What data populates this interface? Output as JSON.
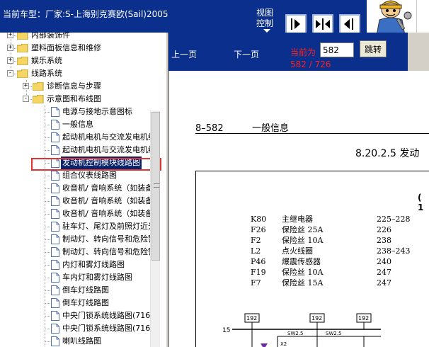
{
  "header": {
    "vehicle_info": "当前车型：厂家:S-上海别克赛欧(Sail)2005",
    "view_control": "视图控制"
  },
  "tree": {
    "items": [
      {
        "label": "内部装饰件",
        "level": 1,
        "type": "folder",
        "expander": "+"
      },
      {
        "label": "塑料面板信息和维修",
        "level": 1,
        "type": "folder",
        "expander": "+"
      },
      {
        "label": "娱乐系统",
        "level": 1,
        "type": "folder",
        "expander": "+"
      },
      {
        "label": "线路系统",
        "level": 1,
        "type": "folder",
        "expander": "-"
      },
      {
        "label": "诊断信息与步骤",
        "level": 2,
        "type": "folder",
        "expander": "+"
      },
      {
        "label": "示意图和布线图",
        "level": 2,
        "type": "folder",
        "expander": "-"
      },
      {
        "label": "电源与接地示意图标",
        "level": 3,
        "type": "doc"
      },
      {
        "label": "一般信息",
        "level": 3,
        "type": "doc"
      },
      {
        "label": "起动机电机与交流发电机线",
        "level": 3,
        "type": "doc"
      },
      {
        "label": "起动机电机与交流发电机线",
        "level": 3,
        "type": "doc"
      },
      {
        "label": "发动机控制模块线路图",
        "level": 3,
        "type": "doc",
        "selected": true
      },
      {
        "label": "组合仪表线路图",
        "level": 3,
        "type": "doc"
      },
      {
        "label": "收音机/ 音响系统（如装备",
        "level": 3,
        "type": "doc"
      },
      {
        "label": "收音机/ 音响系统（如装备",
        "level": 3,
        "type": "doc"
      },
      {
        "label": "收音机/ 音响系统（如装备",
        "level": 3,
        "type": "doc"
      },
      {
        "label": "驻车灯、尾灯及前照灯近光",
        "level": 3,
        "type": "doc"
      },
      {
        "label": "制动灯、转向信号和危险警",
        "level": 3,
        "type": "doc"
      },
      {
        "label": "制动灯、转向信号和危险警",
        "level": 3,
        "type": "doc"
      },
      {
        "label": "内灯和雾灯线路图",
        "level": 3,
        "type": "doc"
      },
      {
        "label": "车内灯和雾灯线路图",
        "level": 3,
        "type": "doc"
      },
      {
        "label": "倒车灯线路图",
        "level": 3,
        "type": "doc"
      },
      {
        "label": "倒车灯线路图",
        "level": 3,
        "type": "doc"
      },
      {
        "label": "中央门锁系统线路图(716",
        "level": 3,
        "type": "doc"
      },
      {
        "label": "中央门锁系统线路图(716",
        "level": 3,
        "type": "doc"
      },
      {
        "label": "喇叭线路图",
        "level": 3,
        "type": "doc"
      }
    ]
  },
  "nav": {
    "prev_label": "上一页",
    "next_label": "下一页",
    "current_label": "当前为",
    "page_value": "582",
    "jump_label": "跳转",
    "page_count": "582 / 726"
  },
  "document": {
    "page_number": "8–582",
    "page_heading": "一般信息",
    "section_title": "8.20.2.5 发动",
    "frame_label": "( 1",
    "legend": [
      {
        "code": "K80",
        "name": "主继电器",
        "page": "225–228"
      },
      {
        "code": "F26",
        "name": "保险丝 25A",
        "page": "226"
      },
      {
        "code": "F2",
        "name": "保险丝 10A",
        "page": "238"
      },
      {
        "code": "L2",
        "name": "点火线圈",
        "page": "238–243"
      },
      {
        "code": "P46",
        "name": "爆震传感器",
        "page": "240"
      },
      {
        "code": "F19",
        "name": "保险丝 10A",
        "page": "247"
      },
      {
        "code": "F7",
        "name": "保险丝 15A",
        "page": "247"
      }
    ],
    "diagram": {
      "wire_number": "15",
      "connector_labels": [
        "192",
        "192",
        "192"
      ],
      "switch_labels": [
        "SW2.5",
        "SW2.5"
      ],
      "pin_label": "X2"
    }
  },
  "icons": {
    "view_buttons": [
      "arrow-right-bar-icon",
      "arrows-inward-icon",
      "arrow-left-bar-icon"
    ]
  }
}
